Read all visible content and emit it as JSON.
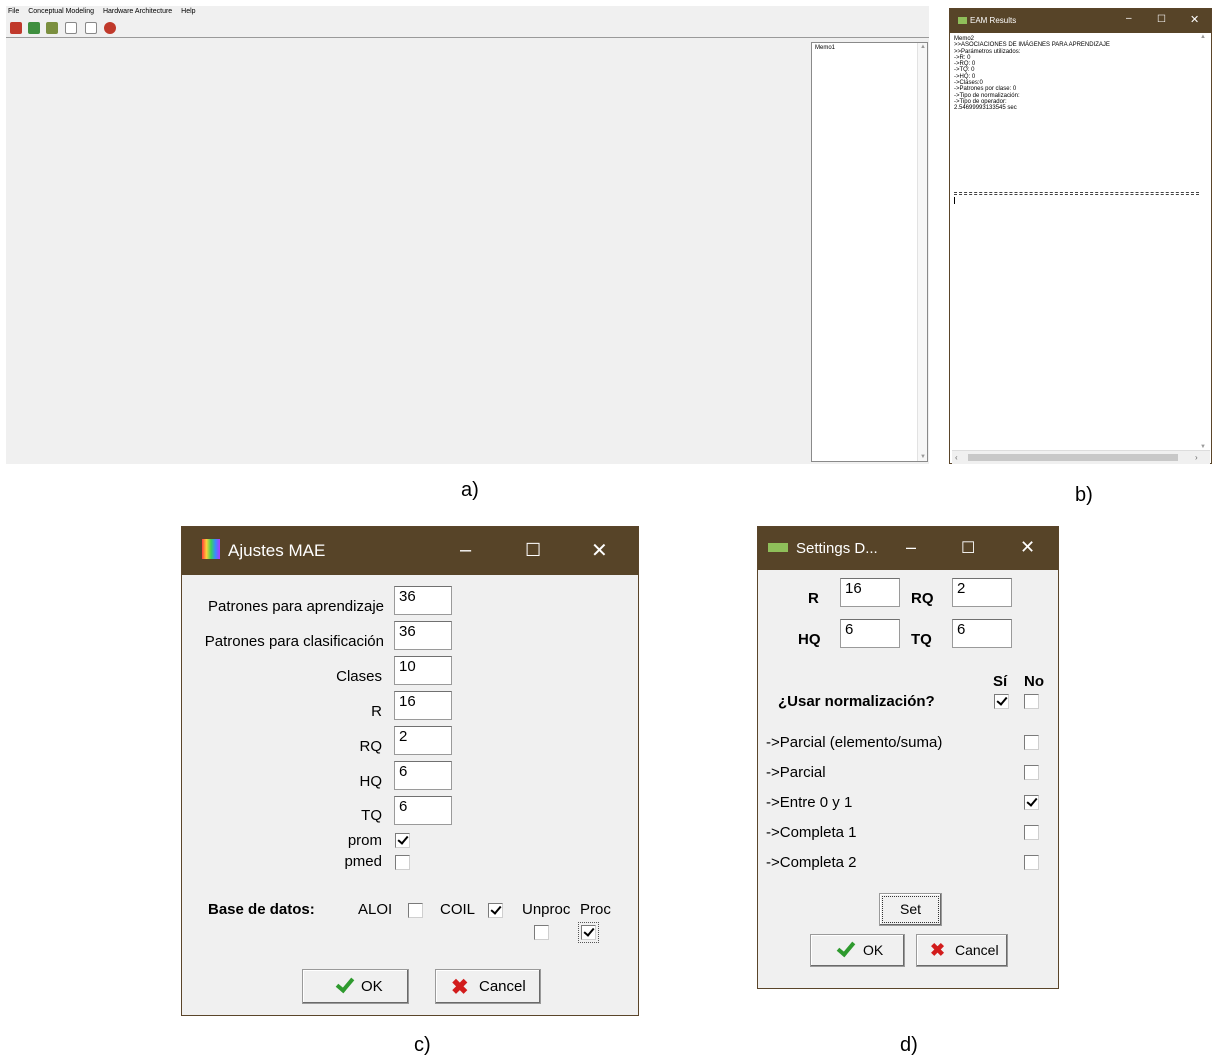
{
  "captions": {
    "a": "a)",
    "b": "b)",
    "c": "c)",
    "d": "d)"
  },
  "panel_a": {
    "menu": [
      "File",
      "Conceptual Modeling",
      "Hardware Architecture",
      "Help"
    ],
    "toolbar_icons": [
      "open-icon",
      "save-icon",
      "save-as-icon",
      "run-icon",
      "step-icon",
      "stop-icon"
    ],
    "memo_text": "Memo1",
    "colors": {
      "toolbar_icon_red": "#c0392b",
      "toolbar_icon_green": "#3f8f3f"
    }
  },
  "panel_b": {
    "title": "EAM Results",
    "memo_lines": [
      "Memo2",
      ">>ASOCIACIONES DE IMÁGENES PARA APRENDIZAJE",
      "",
      ">>Parámetros utilizados:",
      "->R: 0",
      "->RQ: 0",
      "->TQ: 0",
      "->HQ: 0",
      "->Clases:0",
      "->Patrones por clase: 0",
      "->Tipo de normalización:",
      "->Tipo de operador:",
      "",
      "2.54699993133545 sec"
    ]
  },
  "panel_c": {
    "title": "Ajustes MAE",
    "fields": [
      {
        "label": "Patrones para aprendizaje",
        "value": "36"
      },
      {
        "label": "Patrones para clasificación",
        "value": "36"
      },
      {
        "label": "Clases",
        "value": "10"
      },
      {
        "label": "R",
        "value": "16"
      },
      {
        "label": "RQ",
        "value": "2"
      },
      {
        "label": "HQ",
        "value": "6"
      },
      {
        "label": "TQ",
        "value": "6"
      }
    ],
    "checks": [
      {
        "label": "prom",
        "checked": true
      },
      {
        "label": "pmed",
        "checked": false
      }
    ],
    "database": {
      "label": "Base de datos:",
      "options": [
        {
          "label": "ALOI",
          "checked": false
        },
        {
          "label": "COIL",
          "checked": true
        }
      ],
      "unproc_label": "Unproc",
      "unproc_checked": false,
      "proc_label": "Proc",
      "proc_checked": true
    },
    "ok_label": "OK",
    "cancel_label": "Cancel",
    "colors": {
      "titlebar": "#574428",
      "ok_check": "#2e9a2e",
      "cancel_x": "#d21c1c"
    }
  },
  "panel_d": {
    "title": "Settings D...",
    "fields": [
      {
        "label": "R",
        "value": "16"
      },
      {
        "label": "RQ",
        "value": "2"
      },
      {
        "label": "HQ",
        "value": "6"
      },
      {
        "label": "TQ",
        "value": "6"
      }
    ],
    "si_label": "Sí",
    "no_label": "No",
    "question": "¿Usar normalización?",
    "question_si_checked": true,
    "question_no_checked": false,
    "options": [
      {
        "label": "->Parcial (elemento/suma)",
        "checked": false
      },
      {
        "label": "->Parcial",
        "checked": false
      },
      {
        "label": "->Entre 0 y 1",
        "checked": true
      },
      {
        "label": "->Completa 1",
        "checked": false
      },
      {
        "label": "->Completa 2",
        "checked": false
      }
    ],
    "set_label": "Set",
    "ok_label": "OK",
    "cancel_label": "Cancel"
  }
}
